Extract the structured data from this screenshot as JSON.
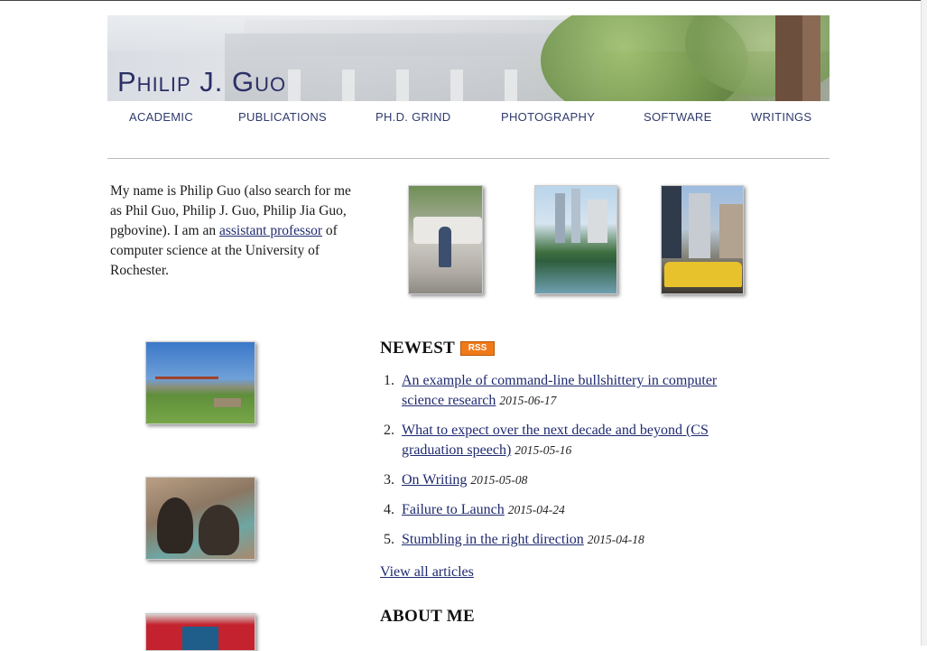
{
  "banner": {
    "title": "Philip J. Guo"
  },
  "nav": [
    {
      "label": "ACADEMIC"
    },
    {
      "label": "PUBLICATIONS"
    },
    {
      "label": "PH.D. GRIND"
    },
    {
      "label": "PHOTOGRAPHY"
    },
    {
      "label": "SOFTWARE"
    },
    {
      "label": "WRITINGS"
    }
  ],
  "intro": {
    "text_before": "My name is Philip Guo (also search for me as Phil Guo, Philip J. Guo, Philip Jia Guo, pgbovine). I am an ",
    "link": "assistant professor",
    "text_after": " of computer science at the University of Rochester."
  },
  "newest": {
    "heading": "NEWEST",
    "rss_label": "RSS",
    "items": [
      {
        "num": "1.",
        "title": "An example of command-line bullshittery in computer science research",
        "date": "2015-06-17"
      },
      {
        "num": "2.",
        "title": "What to expect over the next decade and beyond (CS graduation speech)",
        "date": "2015-05-16"
      },
      {
        "num": "3.",
        "title": "On Writing",
        "date": "2015-05-08"
      },
      {
        "num": "4.",
        "title": "Failure to Launch",
        "date": "2015-04-24"
      },
      {
        "num": "5.",
        "title": "Stumbling in the right direction",
        "date": "2015-04-18"
      }
    ],
    "view_all": "View all articles"
  },
  "about": {
    "heading": "ABOUT ME"
  }
}
